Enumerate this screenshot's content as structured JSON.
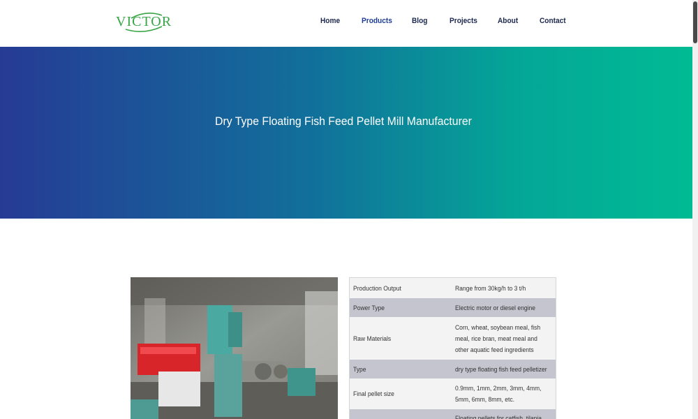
{
  "brand": {
    "name": "VICTOR",
    "color": "#3aa547"
  },
  "nav": {
    "items": [
      {
        "label": "Home",
        "active": false
      },
      {
        "label": "Products",
        "active": true
      },
      {
        "label": "Blog",
        "active": false
      },
      {
        "label": "Projects",
        "active": false
      },
      {
        "label": "About",
        "active": false
      },
      {
        "label": "Contact",
        "active": false
      }
    ]
  },
  "hero": {
    "title": "Dry Type Floating Fish Feed Pellet Mill Manufacturer",
    "gradient": [
      "#263b95",
      "#00bb94"
    ]
  },
  "product_image": {
    "icon": "pellet-mill-photo"
  },
  "specs": [
    {
      "key": "Production Output",
      "value": "Range from 30kg/h to 3 t/h"
    },
    {
      "key": "Power Type",
      "value": "Electric motor or diesel engine"
    },
    {
      "key": "Raw Materials",
      "value": "Corn, wheat, soybean meal, fish meal, rice bran, meat meal and other aquatic feed ingredients"
    },
    {
      "key": "Type",
      "value": "dry type floating fish feed pelletizer"
    },
    {
      "key": "Final pellet size",
      "value": "0.9mm, 1mm, 2mm, 3mm, 4mm, 5mm, 6mm, 8mm, etc."
    },
    {
      "key": "",
      "value": "Floating pellets for catfish, tilapia"
    }
  ]
}
